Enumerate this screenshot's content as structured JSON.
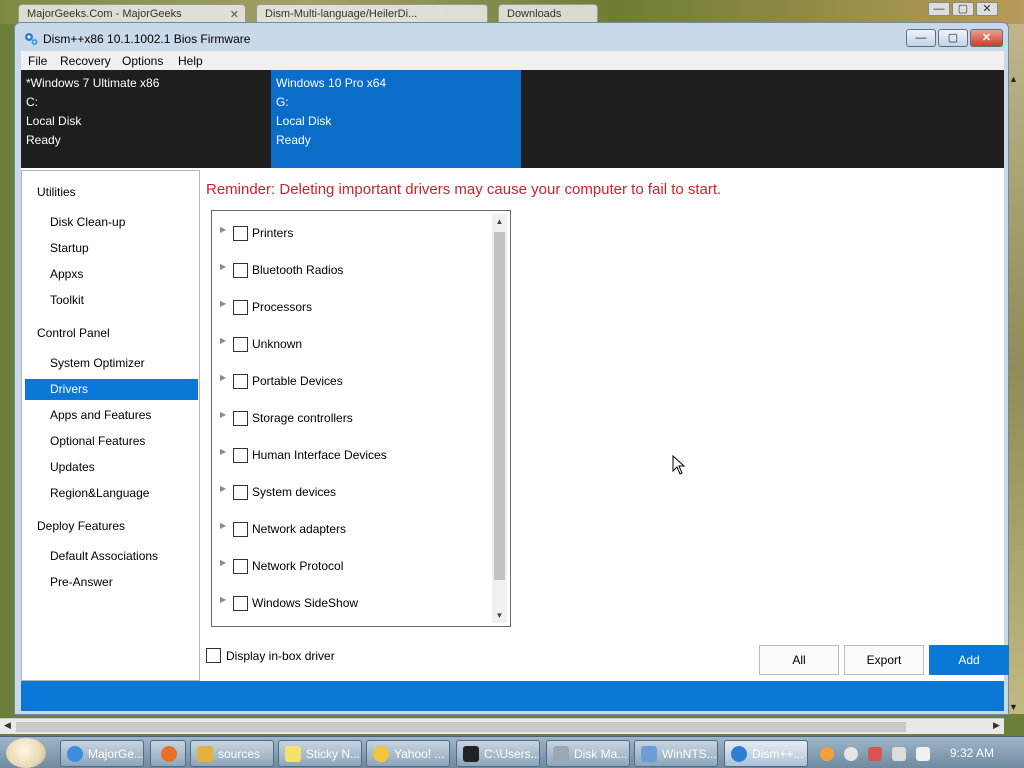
{
  "background_browser": {
    "tabs": [
      "MajorGeeks.Com - MajorGeeks",
      "Dism-Multi-language/HeilerDi...",
      "Downloads"
    ]
  },
  "window": {
    "title": "Dism++x86 10.1.1002.1 Bios Firmware",
    "controls": {
      "minimize": "—",
      "maximize": "▢",
      "close": "✕"
    }
  },
  "menu": [
    "File",
    "Recovery",
    "Options",
    "Help"
  ],
  "images": [
    {
      "name": "*Windows 7 Ultimate x86",
      "drive": "C:",
      "type": "Local Disk",
      "status": "Ready",
      "selected": false
    },
    {
      "name": "Windows 10 Pro x64",
      "drive": "G:",
      "type": "Local Disk",
      "status": "Ready",
      "selected": true
    }
  ],
  "sidebar": {
    "utilities": {
      "label": "Utilities",
      "items": [
        "Disk Clean-up",
        "Startup",
        "Appxs",
        "Toolkit"
      ]
    },
    "control_panel": {
      "label": "Control Panel",
      "items": [
        "System Optimizer",
        "Drivers",
        "Apps and Features",
        "Optional Features",
        "Updates",
        "Region&Language"
      ]
    },
    "deploy": {
      "label": "Deploy Features",
      "items": [
        "Default Associations",
        "Pre-Answer"
      ]
    },
    "active": "Drivers"
  },
  "main": {
    "reminder": "Reminder: Deleting important drivers may cause your computer to fail to start.",
    "driver_categories": [
      "Printers",
      "Bluetooth Radios",
      "Processors",
      "Unknown",
      "Portable Devices",
      "Storage controllers",
      "Human Interface Devices",
      "System devices",
      "Network adapters",
      "Network Protocol",
      "Windows SideShow"
    ],
    "display_inbox_label": "Display in-box driver",
    "buttons": {
      "all": "All",
      "export": "Export",
      "add": "Add"
    }
  },
  "taskbar": {
    "items": [
      {
        "label": "MajorGe...",
        "color": "#3b8ede"
      },
      {
        "label": "",
        "color": "#e8702a"
      },
      {
        "label": "sources",
        "color": "#e3b23c"
      },
      {
        "label": "Sticky N...",
        "color": "#f3e36a"
      },
      {
        "label": "Yahoo! ...",
        "color": "#f2c53a"
      },
      {
        "label": "C:\\Users...",
        "color": "#222222"
      },
      {
        "label": "Disk Ma...",
        "color": "#9aa7b4"
      },
      {
        "label": "WinNTS...",
        "color": "#6b9ed6"
      },
      {
        "label": "Dism++...",
        "color": "#2f7ed6"
      }
    ],
    "clock": "9:32 AM"
  },
  "colors": {
    "accent": "#0a78d6",
    "reminder": "#c8242f",
    "header_dark": "#1e1e1e"
  }
}
